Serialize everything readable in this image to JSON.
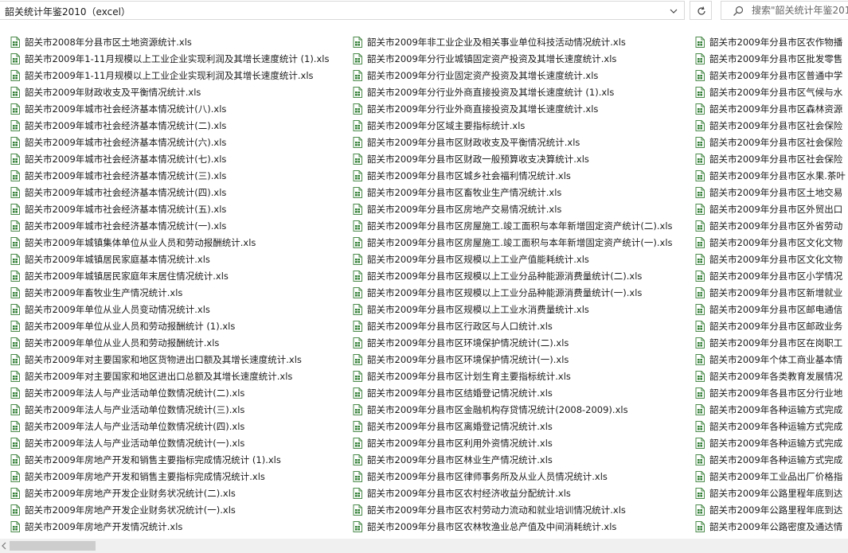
{
  "address_bar": {
    "path": "韶关统计年鉴2010（excel）"
  },
  "search": {
    "placeholder": "搜索\"韶关统计年鉴2010（excel）\""
  },
  "columns": [
    [
      "韶关市2008年分县市区土地资源统计.xls",
      "韶关市2009年1-11月规模以上工业企业实现利润及其增长速度统计 (1).xls",
      "韶关市2009年1-11月规模以上工业企业实现利润及其增长速度统计.xls",
      "韶关市2009年财政收支及平衡情况统计.xls",
      "韶关市2009年城市社会经济基本情况统计(八).xls",
      "韶关市2009年城市社会经济基本情况统计(二).xls",
      "韶关市2009年城市社会经济基本情况统计(六).xls",
      "韶关市2009年城市社会经济基本情况统计(七).xls",
      "韶关市2009年城市社会经济基本情况统计(三).xls",
      "韶关市2009年城市社会经济基本情况统计(四).xls",
      "韶关市2009年城市社会经济基本情况统计(五).xls",
      "韶关市2009年城市社会经济基本情况统计(一).xls",
      "韶关市2009年城镇集体单位从业人员和劳动报酬统计.xls",
      "韶关市2009年城镇居民家庭基本情况统计.xls",
      "韶关市2009年城镇居民家庭年末居住情况统计.xls",
      "韶关市2009年畜牧业生产情况统计.xls",
      "韶关市2009年单位从业人员变动情况统计.xls",
      "韶关市2009年单位从业人员和劳动报酬统计 (1).xls",
      "韶关市2009年单位从业人员和劳动报酬统计.xls",
      "韶关市2009年对主要国家和地区货物进出口额及其增长速度统计.xls",
      "韶关市2009年对主要国家和地区进出口总额及其增长速度统计.xls",
      "韶关市2009年法人与产业活动单位数情况统计(二).xls",
      "韶关市2009年法人与产业活动单位数情况统计(三).xls",
      "韶关市2009年法人与产业活动单位数情况统计(四).xls",
      "韶关市2009年法人与产业活动单位数情况统计(一).xls",
      "韶关市2009年房地产开发和销售主要指标完成情况统计 (1).xls",
      "韶关市2009年房地产开发和销售主要指标完成情况统计.xls",
      "韶关市2009年房地产开发企业财务状况统计(二).xls",
      "韶关市2009年房地产开发企业财务状况统计(一).xls",
      "韶关市2009年房地产开发情况统计.xls"
    ],
    [
      "韶关市2009年非工业企业及相关事业单位科技活动情况统计.xls",
      "韶关市2009年分行业城镇固定资产投资及其增长速度统计.xls",
      "韶关市2009年分行业固定资产投资及其增长速度统计.xls",
      "韶关市2009年分行业外商直接投资及其增长速度统计 (1).xls",
      "韶关市2009年分行业外商直接投资及其增长速度统计.xls",
      "韶关市2009年分区域主要指标统计.xls",
      "韶关市2009年分县市区财政收支及平衡情况统计.xls",
      "韶关市2009年分县市区财政一般预算收支决算统计.xls",
      "韶关市2009年分县市区城乡社会福利情况统计.xls",
      "韶关市2009年分县市区畜牧业生产情况统计.xls",
      "韶关市2009年分县市区房地产交易情况统计.xls",
      "韶关市2009年分县市区房屋施工.竣工面积与本年新增固定资产统计(二).xls",
      "韶关市2009年分县市区房屋施工.竣工面积与本年新增固定资产统计(一).xls",
      "韶关市2009年分县市区规模以上工业产值能耗统计.xls",
      "韶关市2009年分县市区规模以上工业分品种能源消费量统计(二).xls",
      "韶关市2009年分县市区规模以上工业分品种能源消费量统计(一).xls",
      "韶关市2009年分县市区规模以上工业水消费量统计.xls",
      "韶关市2009年分县市区行政区与人口统计.xls",
      "韶关市2009年分县市区环境保护情况统计(二).xls",
      "韶关市2009年分县市区环境保护情况统计(一).xls",
      "韶关市2009年分县市区计划生育主要指标统计.xls",
      "韶关市2009年分县市区结婚登记情况统计.xls",
      "韶关市2009年分县市区金融机构存贷情况统计(2008-2009).xls",
      "韶关市2009年分县市区离婚登记情况统计.xls",
      "韶关市2009年分县市区利用外资情况统计.xls",
      "韶关市2009年分县市区林业生产情况统计.xls",
      "韶关市2009年分县市区律师事务所及从业人员情况统计.xls",
      "韶关市2009年分县市区农村经济收益分配统计.xls",
      "韶关市2009年分县市区农村劳动力流动和就业培训情况统计.xls",
      "韶关市2009年分县市区农林牧渔业总产值及中间消耗统计.xls"
    ],
    [
      "韶关市2009年分县市区农作物播",
      "韶关市2009年分县市区批发零售",
      "韶关市2009年分县市区普通中学",
      "韶关市2009年分县市区气候与水",
      "韶关市2009年分县市区森林资源",
      "韶关市2009年分县市区社会保险",
      "韶关市2009年分县市区社会保险",
      "韶关市2009年分县市区社会保险",
      "韶关市2009年分县市区水果.茶叶",
      "韶关市2009年分县市区土地交易",
      "韶关市2009年分县市区外贸出口",
      "韶关市2009年分县市区外省劳动",
      "韶关市2009年分县市区文化文物",
      "韶关市2009年分县市区文化文物",
      "韶关市2009年分县市区小学情况",
      "韶关市2009年分县市区新增就业",
      "韶关市2009年分县市区邮电通信",
      "韶关市2009年分县市区邮政业务",
      "韶关市2009年分县市区在岗职工",
      "韶关市2009年个体工商业基本情",
      "韶关市2009年各类教育发展情况",
      "韶关市2009年各县市区分行业地",
      "韶关市2009年各种运输方式完成",
      "韶关市2009年各种运输方式完成",
      "韶关市2009年各种运输方式完成",
      "韶关市2009年各种运输方式完成",
      "韶关市2009年工业品出厂价格指",
      "韶关市2009年公路里程年底到达",
      "韶关市2009年公路里程年底到达",
      "韶关市2009年公路密度及通达情"
    ]
  ]
}
